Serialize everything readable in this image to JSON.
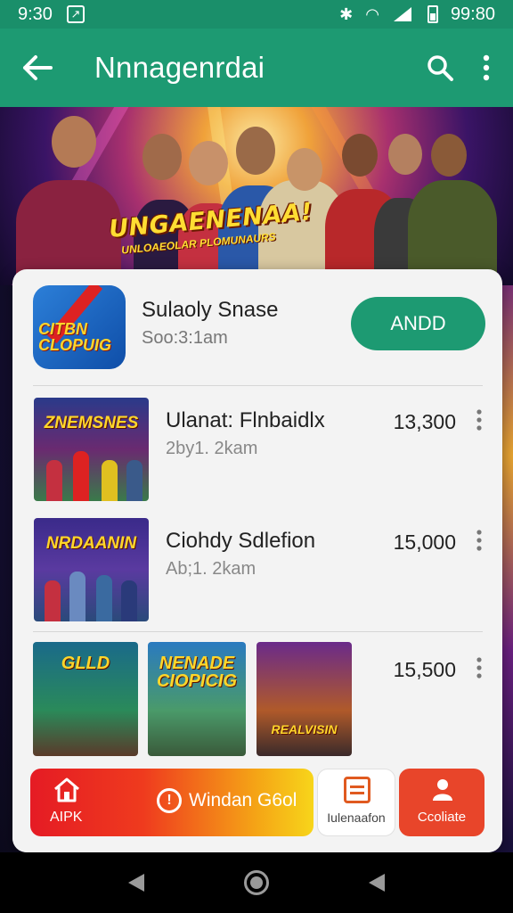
{
  "status_bar": {
    "time": "9:30",
    "battery": "99:80"
  },
  "app_bar": {
    "title": "Nnnagenrdai"
  },
  "hero": {
    "title": "UNGAENENAA!",
    "subtitle": "UNLOAEOLAR PLOMUNAURS"
  },
  "featured": {
    "icon_text": "CITBN CLOPUIG",
    "name": "Sulaoly Snase",
    "subtitle": "Soo:3:1am",
    "add_label": "ANDD"
  },
  "items": [
    {
      "thumb_title": "ZNEMSNES",
      "name": "Ulanat: Flnbaidlx",
      "subtitle": "2by1. 2kam",
      "count": "13,300"
    },
    {
      "thumb_title": "NRDAANIN",
      "name": "Ciohdy Sdlefion",
      "subtitle": "Ab;1. 2kam",
      "count": "15,000"
    }
  ],
  "triple": {
    "thumbs": [
      "GLLD",
      "NENADE CIOPICIG",
      "REALVISIN"
    ],
    "count": "15,500"
  },
  "actions": {
    "apk_label": "AIPK",
    "warn_label": "Windan G6ol",
    "info_label": "Iulenaafon",
    "create_label": "Ccoliate"
  },
  "icons": {
    "back": "arrow-left",
    "search": "magnifier",
    "more": "vertical-dots",
    "home": "house",
    "warning": "exclamation-circle",
    "info": "list-card",
    "create": "person"
  },
  "colors": {
    "accent": "#1d9a72",
    "warn_gradient_start": "#e51b24",
    "warn_gradient_end": "#f7d51a",
    "create": "#e8452a"
  }
}
